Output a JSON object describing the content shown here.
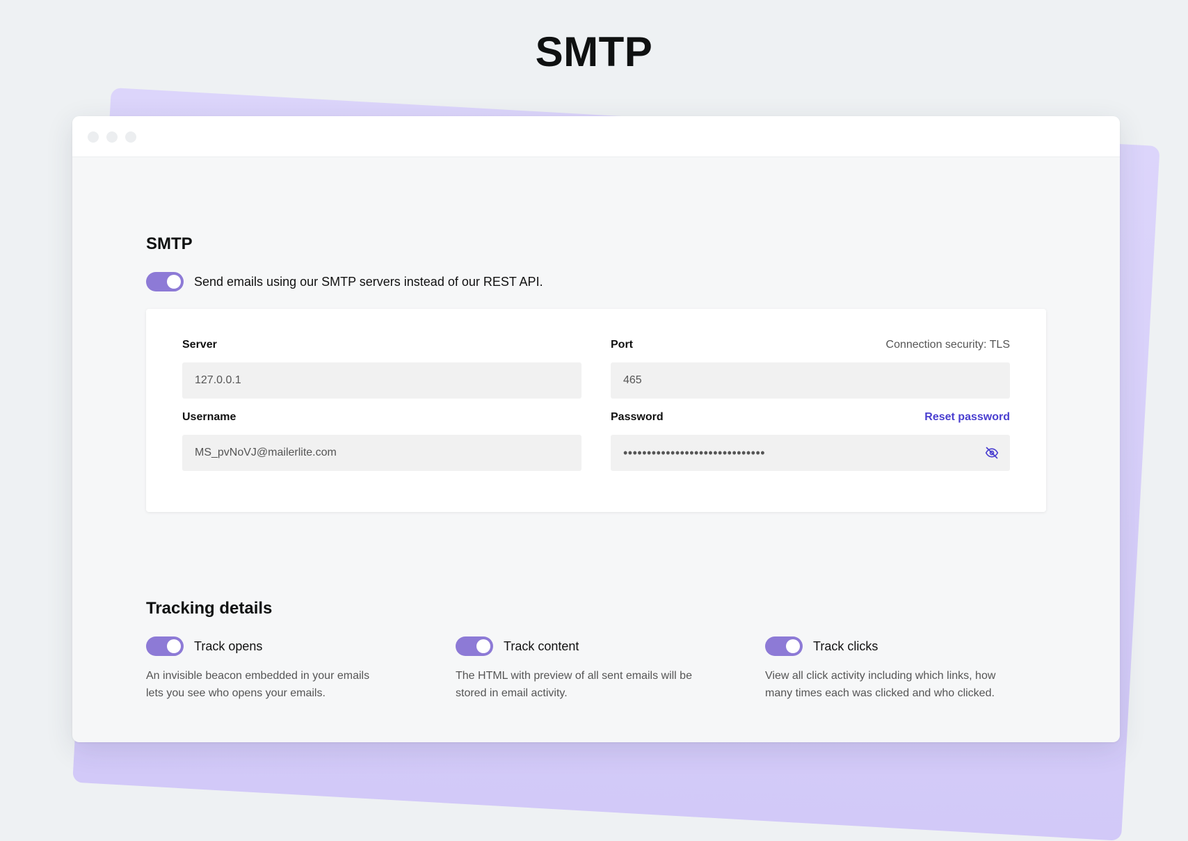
{
  "hero": {
    "title": "SMTP"
  },
  "smtp": {
    "title": "SMTP",
    "toggle_label": "Send emails using our SMTP servers instead of our REST API.",
    "toggle_on": true,
    "server": {
      "label": "Server",
      "value": "127.0.0.1"
    },
    "port": {
      "label": "Port",
      "meta": "Connection security: TLS",
      "value": "465"
    },
    "username": {
      "label": "Username",
      "value": "MS_pvNoVJ@mailerlite.com"
    },
    "password": {
      "label": "Password",
      "link": "Reset password",
      "value": "••••••••••••••••••••••••••••••"
    }
  },
  "tracking": {
    "title": "Tracking details",
    "items": [
      {
        "label": "Track opens",
        "desc": "An invisible beacon embedded in your emails lets you see who opens your emails.",
        "on": true
      },
      {
        "label": "Track content",
        "desc": "The HTML with preview of all sent emails will be stored in email activity.",
        "on": true
      },
      {
        "label": "Track clicks",
        "desc": "View all click activity including which links, how many times each was clicked and who clicked.",
        "on": true
      }
    ]
  },
  "colors": {
    "accent": "#8d7ad6",
    "link": "#4a3fd0",
    "backdrop": "#d6cdfa"
  }
}
